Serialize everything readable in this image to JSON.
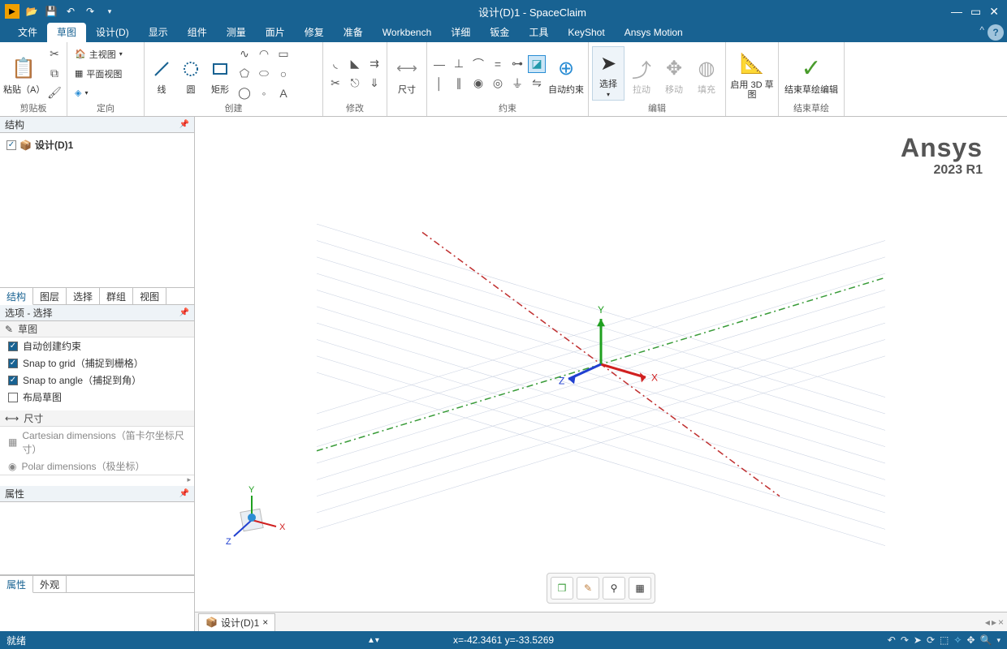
{
  "title": "设计(D)1 - SpaceClaim",
  "menubar": {
    "tabs": [
      "文件",
      "草图",
      "设计(D)",
      "显示",
      "组件",
      "测量",
      "面片",
      "修复",
      "准备",
      "Workbench",
      "详细",
      "钣金",
      "工具",
      "KeyShot",
      "Ansys Motion"
    ],
    "active_index": 1
  },
  "ribbon": {
    "groups": {
      "clipboard": {
        "label": "剪贴板",
        "paste": "粘贴（A）"
      },
      "orient": {
        "label": "定向",
        "home": "主视图",
        "plan": "平面视图"
      },
      "create": {
        "label": "创建",
        "line": "线",
        "circle": "圆",
        "rect": "矩形"
      },
      "modify": {
        "label": "修改"
      },
      "dim": {
        "label": "尺寸"
      },
      "constrain": {
        "label": "约束",
        "auto": "自动约束"
      },
      "edit": {
        "label": "编辑",
        "select": "选择",
        "pull": "拉动",
        "move": "移动",
        "fill": "填充"
      },
      "sketch3d": {
        "label": "启用 3D 草图"
      },
      "end": {
        "label": "结束草绘",
        "btn": "结束草绘编辑"
      }
    }
  },
  "left": {
    "structure_hdr": "结构",
    "root": "设计(D)1",
    "bottom_tabs": [
      "结构",
      "图层",
      "选择",
      "群组",
      "视图"
    ],
    "options_hdr": "选项 - 选择",
    "sketch_hdr": "草图",
    "opts": {
      "auto_constraint": "自动创建约束",
      "snap_grid": "Snap to grid（捕捉到栅格）",
      "snap_angle": "Snap to angle（捕捉到角）",
      "layout_sketch": "布局草图"
    },
    "dim_hdr": "尺寸",
    "cartesian": "Cartesian dimensions（笛卡尔坐标尺寸）",
    "polar": "Polar dimensions（极坐标）",
    "props_hdr": "属性",
    "prop_tabs": [
      "属性",
      "外观"
    ]
  },
  "brand": {
    "name": "Ansys",
    "version": "2023 R1"
  },
  "doc_tab": "设计(D)1",
  "status": {
    "ready": "就绪",
    "coords": "x=-42.3461  y=-33.5269"
  },
  "triad": {
    "x": "X",
    "y": "Y",
    "z": "Z"
  }
}
